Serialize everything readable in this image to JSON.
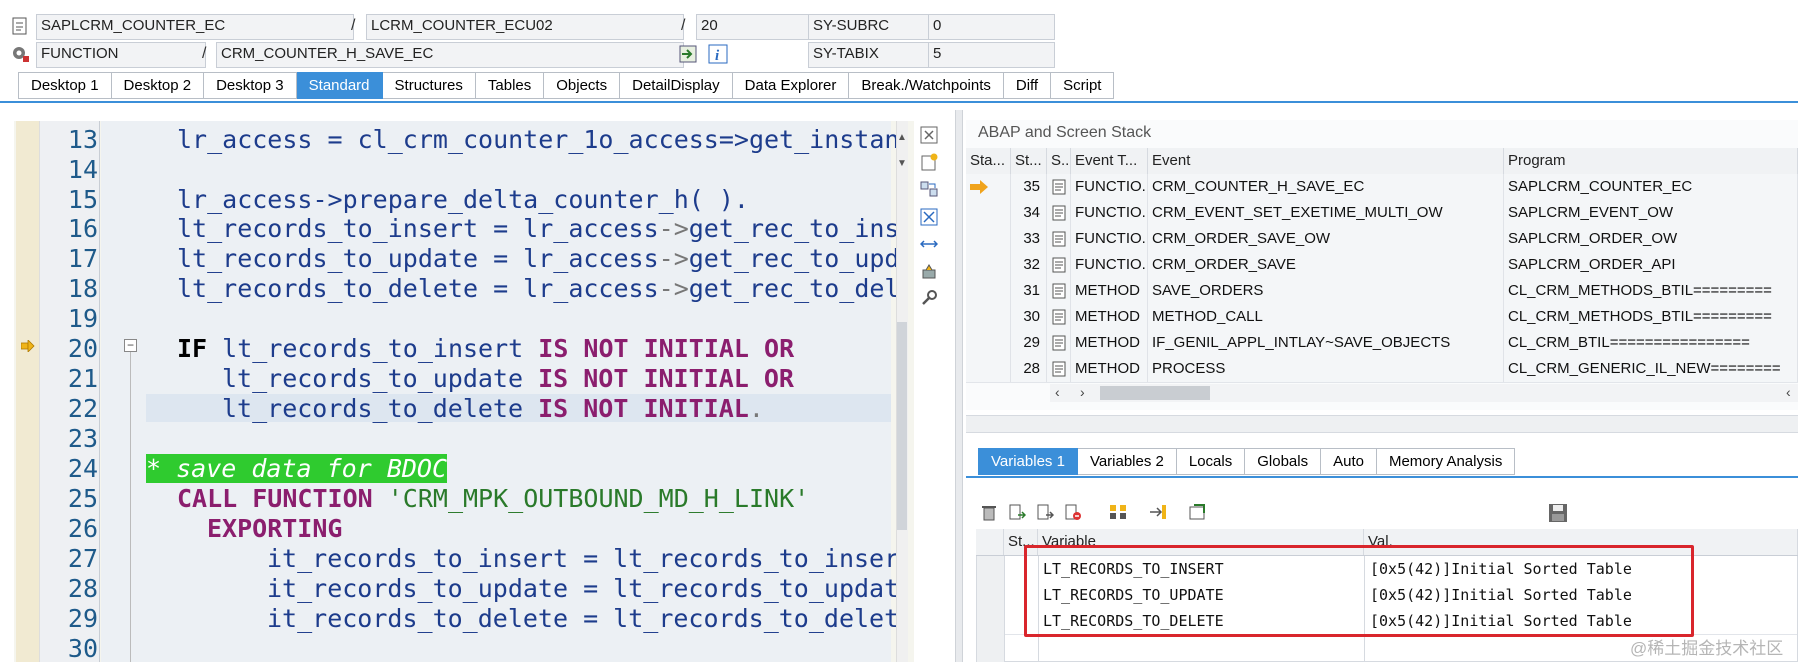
{
  "header": {
    "row1": {
      "program": "SAPLCRM_COUNTER_EC",
      "include": "LCRM_COUNTER_ECU02",
      "line": "20",
      "sysvar_name": "SY-SUBRC",
      "sysvar_value": "0"
    },
    "row2": {
      "type": "FUNCTION",
      "name": "CRM_COUNTER_H_SAVE_EC",
      "sysvar_name": "SY-TABIX",
      "sysvar_value": "5"
    },
    "separator": "/"
  },
  "tabs": [
    "Desktop 1",
    "Desktop 2",
    "Desktop 3",
    "Standard",
    "Structures",
    "Tables",
    "Objects",
    "DetailDisplay",
    "Data Explorer",
    "Break./Watchpoints",
    "Diff",
    "Script"
  ],
  "active_tab": "Standard",
  "code": {
    "line_numbers": [
      "13",
      "14",
      "15",
      "16",
      "17",
      "18",
      "19",
      "20",
      "21",
      "22",
      "23",
      "24",
      "25",
      "26",
      "27",
      "28",
      "29",
      "30"
    ],
    "lines": {
      "l13": "lr_access = cl_crm_counter_1o_access=>get_instan",
      "l15": "lr_access->prepare_delta_counter_h( ).",
      "l16a": "lt_records_to_insert = lr_access",
      "l16b": "get_rec_to_ins",
      "l17a": "lt_records_to_update = lr_access",
      "l17b": "get_rec_to_upd",
      "l18a": "lt_records_to_delete = lr_access",
      "l18b": "get_rec_to_del",
      "l20_kw": "IF",
      "l20_var": "lt_records_to_insert",
      "l20_rest": "IS NOT INITIAL OR",
      "l21_var": "lt_records_to_update",
      "l21_rest": "IS NOT INITIAL OR",
      "l22_var": "lt_records_to_delete",
      "l22_rest": "IS NOT INITIAL",
      "l24": "* save data for BDOC",
      "l25_kw": "CALL FUNCTION",
      "l25_str": "'CRM_MPK_OUTBOUND_MD_H_LINK'",
      "l26": "EXPORTING",
      "l27": "it_records_to_insert = lt_records_to_inser",
      "l28": "it_records_to_update = lt_records_to_updat",
      "l29": "it_records_to_delete = lt_records_to_delet",
      "arrow": "->",
      "dot": "."
    },
    "current_line": "20",
    "fold_marker": "−"
  },
  "stack": {
    "title": "ABAP and Screen Stack",
    "headers": [
      "Sta...",
      "St...",
      "S..",
      "Event T...",
      "Event",
      "Program"
    ],
    "rows": [
      {
        "level": "35",
        "type": "FUNCTIO...",
        "event": "CRM_COUNTER_H_SAVE_EC",
        "program": "SAPLCRM_COUNTER_EC",
        "current": true
      },
      {
        "level": "34",
        "type": "FUNCTIO...",
        "event": "CRM_EVENT_SET_EXETIME_MULTI_OW",
        "program": "SAPLCRM_EVENT_OW",
        "current": false
      },
      {
        "level": "33",
        "type": "FUNCTIO...",
        "event": "CRM_ORDER_SAVE_OW",
        "program": "SAPLCRM_ORDER_OW",
        "current": false
      },
      {
        "level": "32",
        "type": "FUNCTIO...",
        "event": "CRM_ORDER_SAVE",
        "program": "SAPLCRM_ORDER_API",
        "current": false
      },
      {
        "level": "31",
        "type": "METHOD",
        "event": "SAVE_ORDERS",
        "program": "CL_CRM_METHODS_BTIL=========",
        "current": false
      },
      {
        "level": "30",
        "type": "METHOD",
        "event": "METHOD_CALL",
        "program": "CL_CRM_METHODS_BTIL=========",
        "current": false
      },
      {
        "level": "29",
        "type": "METHOD",
        "event": "IF_GENIL_APPL_INTLAY~SAVE_OBJECTS",
        "program": "CL_CRM_BTIL================",
        "current": false
      },
      {
        "level": "28",
        "type": "METHOD",
        "event": "PROCESS",
        "program": "CL_CRM_GENERIC_IL_NEW========",
        "current": false
      }
    ]
  },
  "var_tabs": [
    "Variables 1",
    "Variables 2",
    "Locals",
    "Globals",
    "Auto",
    "Memory Analysis"
  ],
  "active_var_tab": "Variables 1",
  "variables": {
    "headers": [
      "St...",
      "Variable",
      "Val."
    ],
    "rows": [
      {
        "name": "LT_RECORDS_TO_INSERT",
        "value": "[0x5(42)]Initial Sorted Table"
      },
      {
        "name": "LT_RECORDS_TO_UPDATE",
        "value": "[0x5(42)]Initial Sorted Table"
      },
      {
        "name": "LT_RECORDS_TO_DELETE",
        "value": "[0x5(42)]Initial Sorted Table"
      }
    ]
  },
  "watermark": "@稀土掘金技术社区",
  "colors": {
    "accent": "#3b8fd9",
    "comment_bg": "#2fcb2f",
    "keyword": "#8b1e6e",
    "highlight_box": "#d9262c",
    "stack_arrow": "#f0a31c"
  },
  "icons": [
    "program-icon",
    "settings-gear-icon",
    "execute-jump-icon",
    "info-icon",
    "close-panel-icon",
    "new-object-icon",
    "swap-icon",
    "maximize-icon",
    "horizontal-split-icon",
    "tools-icon",
    "delete-icon",
    "save-icon"
  ]
}
